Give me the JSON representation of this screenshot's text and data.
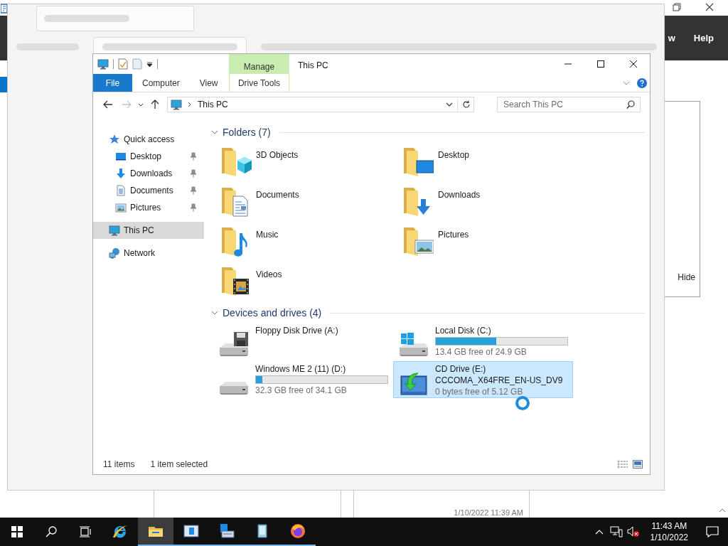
{
  "background_window": {
    "menu_items": [
      {
        "label": "w"
      },
      {
        "label": "Help"
      }
    ],
    "side_button": "Hide",
    "timestamp": "1/10/2022 11:39 AM"
  },
  "window": {
    "title": "This PC"
  },
  "ribbon": {
    "context_group": "Manage",
    "tabs": [
      {
        "label": "File",
        "kind": "file",
        "selected": false
      },
      {
        "label": "Computer",
        "kind": "plain",
        "selected": false
      },
      {
        "label": "View",
        "kind": "plain",
        "selected": false
      },
      {
        "label": "Drive Tools",
        "kind": "context",
        "selected": false
      }
    ]
  },
  "address_bar": {
    "path": "This PC"
  },
  "search": {
    "placeholder": "Search This PC"
  },
  "navigation": {
    "items": [
      {
        "label": "Quick access",
        "kind": "star",
        "selected": false,
        "children": [
          {
            "label": "Desktop",
            "kind": "desktop",
            "pinned": true,
            "selected": false
          },
          {
            "label": "Downloads",
            "kind": "download",
            "pinned": true,
            "selected": false
          },
          {
            "label": "Documents",
            "kind": "document",
            "pinned": true,
            "selected": false
          },
          {
            "label": "Pictures",
            "kind": "picture",
            "pinned": true,
            "selected": false
          }
        ]
      },
      {
        "label": "This PC",
        "kind": "pc",
        "selected": true
      },
      {
        "label": "Network",
        "kind": "network",
        "selected": false
      }
    ]
  },
  "folders": {
    "title": "Folders (7)",
    "items": [
      {
        "name": "3D Objects",
        "kind": "cube",
        "selected": false
      },
      {
        "name": "Desktop",
        "kind": "desktop",
        "selected": false
      },
      {
        "name": "Documents",
        "kind": "document",
        "selected": false
      },
      {
        "name": "Downloads",
        "kind": "download",
        "selected": false
      },
      {
        "name": "Music",
        "kind": "music",
        "selected": false
      },
      {
        "name": "Pictures",
        "kind": "picture",
        "selected": false
      },
      {
        "name": "Videos",
        "kind": "video",
        "selected": false
      }
    ]
  },
  "drives": {
    "title": "Devices and drives (4)",
    "items": [
      {
        "name": "Floppy Disk Drive (A:)",
        "kind": "floppy",
        "selected": false
      },
      {
        "name": "Local Disk (C:)",
        "kind": "windows",
        "level": 0.46,
        "free": "13.4 GB free of 24.9 GB",
        "selected": false
      },
      {
        "name": "Windows ME 2 (11) (D:)",
        "kind": "disk",
        "level": 0.05,
        "free": "32.3 GB free of 34.1 GB",
        "selected": false
      },
      {
        "name": "CD Drive (E:)",
        "volume": "CCCOMA_X64FRE_EN-US_DV9",
        "kind": "cd",
        "free": "0 bytes free of 5.12 GB",
        "selected": true
      }
    ]
  },
  "status_bar": {
    "count": "11 items",
    "selection": "1 item selected"
  },
  "taskbar": {
    "apps": [
      {
        "kind": "ie",
        "running": false,
        "active": false
      },
      {
        "kind": "folder",
        "running": true,
        "active": true
      },
      {
        "kind": "panel",
        "running": true,
        "active": false
      },
      {
        "kind": "server",
        "running": true,
        "active": false
      },
      {
        "kind": "tablet",
        "running": true,
        "active": false
      },
      {
        "kind": "firefox",
        "running": true,
        "active": false
      }
    ],
    "clock": {
      "time": "11:43 AM",
      "date": "1/10/2022"
    }
  }
}
